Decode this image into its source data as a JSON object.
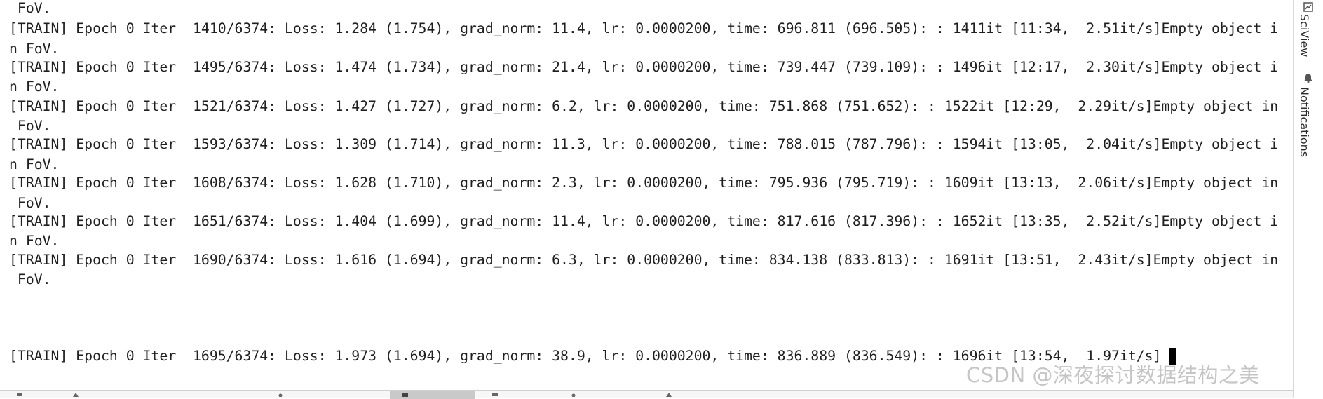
{
  "console": {
    "lines": [
      " FoV.",
      "[TRAIN] Epoch 0 Iter  1410/6374: Loss: 1.284 (1.754), grad_norm: 11.4, lr: 0.0000200, time: 696.811 (696.505): : 1411it [11:34,  2.51it/s]Empty object i",
      "n FoV.",
      "[TRAIN] Epoch 0 Iter  1495/6374: Loss: 1.474 (1.734), grad_norm: 21.4, lr: 0.0000200, time: 739.447 (739.109): : 1496it [12:17,  2.30it/s]Empty object i",
      "n FoV.",
      "[TRAIN] Epoch 0 Iter  1521/6374: Loss: 1.427 (1.727), grad_norm: 6.2, lr: 0.0000200, time: 751.868 (751.652): : 1522it [12:29,  2.29it/s]Empty object in",
      " FoV.",
      "[TRAIN] Epoch 0 Iter  1593/6374: Loss: 1.309 (1.714), grad_norm: 11.3, lr: 0.0000200, time: 788.015 (787.796): : 1594it [13:05,  2.04it/s]Empty object i",
      "n FoV.",
      "[TRAIN] Epoch 0 Iter  1608/6374: Loss: 1.628 (1.710), grad_norm: 2.3, lr: 0.0000200, time: 795.936 (795.719): : 1609it [13:13,  2.06it/s]Empty object in",
      " FoV.",
      "[TRAIN] Epoch 0 Iter  1651/6374: Loss: 1.404 (1.699), grad_norm: 11.4, lr: 0.0000200, time: 817.616 (817.396): : 1652it [13:35,  2.52it/s]Empty object i",
      "n FoV.",
      "[TRAIN] Epoch 0 Iter  1690/6374: Loss: 1.616 (1.694), grad_norm: 6.3, lr: 0.0000200, time: 834.138 (833.813): : 1691it [13:51,  2.43it/s]Empty object in",
      " FoV.",
      "[TRAIN] Epoch 0 Iter  1695/6374: Loss: 1.973 (1.694), grad_norm: 38.9, lr: 0.0000200, time: 836.889 (836.549): : 1696it [13:54,  1.97it/s]"
    ]
  },
  "sidebar": {
    "sciview_label": "SciView",
    "sciview_icon": "sciview-icon",
    "notifications_label": "Notifications",
    "notifications_icon": "bell-icon"
  },
  "watermark": {
    "text": "CSDN @深夜探讨数据结构之美"
  },
  "colors": {
    "console_text": "#1f1f1f",
    "background": "#ffffff",
    "active_tab": "#c9c9c9"
  }
}
